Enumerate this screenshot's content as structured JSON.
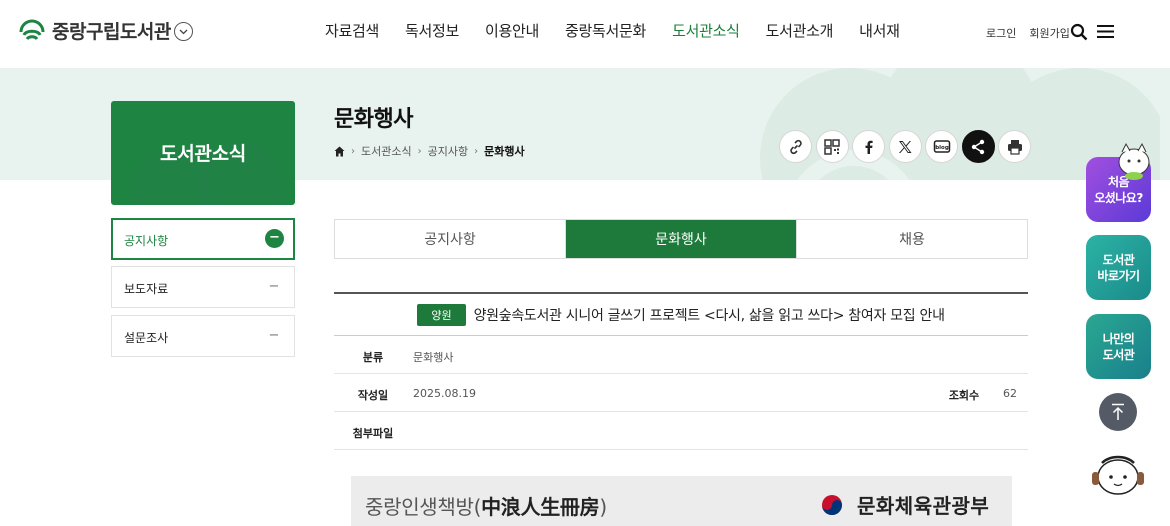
{
  "header": {
    "logo_text": "중랑구립도서관",
    "nav": [
      "자료검색",
      "독서정보",
      "이용안내",
      "중랑독서문화",
      "도서관소식",
      "도서관소개",
      "내서재"
    ],
    "nav_active_index": 4,
    "util_links": [
      "로그인",
      "회원가입"
    ]
  },
  "sidebar": {
    "title": "도서관소식",
    "items": [
      {
        "label": "공지사항",
        "active": true
      },
      {
        "label": "보도자료",
        "active": false
      },
      {
        "label": "설문조사",
        "active": false
      }
    ]
  },
  "content": {
    "title": "문화행사",
    "breadcrumb": [
      "도서관소식",
      "공지사항",
      "문화행사"
    ],
    "share_icons": [
      "link-icon",
      "qr-icon",
      "facebook-icon",
      "x-icon",
      "blog-icon",
      "share-icon",
      "print-icon"
    ]
  },
  "tabs": [
    {
      "label": "공지사항",
      "active": false
    },
    {
      "label": "문화행사",
      "active": true
    },
    {
      "label": "채용",
      "active": false
    }
  ],
  "post": {
    "tag": "양원",
    "title": "양원숲속도서관 시니어 글쓰기 프로젝트 <다시, 삶을 읽고 쓰다> 참여자 모집 안내",
    "category_label": "분류",
    "category_value": "문화행사",
    "date_label": "작성일",
    "date_value": "2025.08.19",
    "views_label": "조회수",
    "views_value": "62",
    "attach_label": "첨부파일"
  },
  "poster": {
    "left_text": "중랑인생책방(",
    "left_hanja": "中浪人生冊房",
    "left_close": ")",
    "ministry": "문화체육관광부"
  },
  "floating": {
    "first_visit": "처음\n오셨나요?",
    "shortcut": "도서관\n바로가기",
    "my_library": "나만의\n도서관"
  },
  "colors": {
    "brand_green": "#1e8442",
    "banner_bg": "#e8f2ee"
  }
}
